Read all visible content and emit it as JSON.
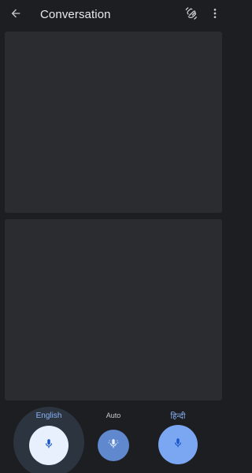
{
  "header": {
    "title": "Conversation",
    "back_icon": "arrow-back-icon",
    "mode_icon": "conversation-mode-icon",
    "more_icon": "more-vert-icon"
  },
  "panels": {
    "top": "",
    "bottom": ""
  },
  "controls": {
    "left_language": "English",
    "auto_label": "Auto",
    "right_language": "हिन्दी"
  },
  "colors": {
    "background": "#1d1e21",
    "panel": "#2b2c30",
    "accent": "#8ab4f8"
  }
}
